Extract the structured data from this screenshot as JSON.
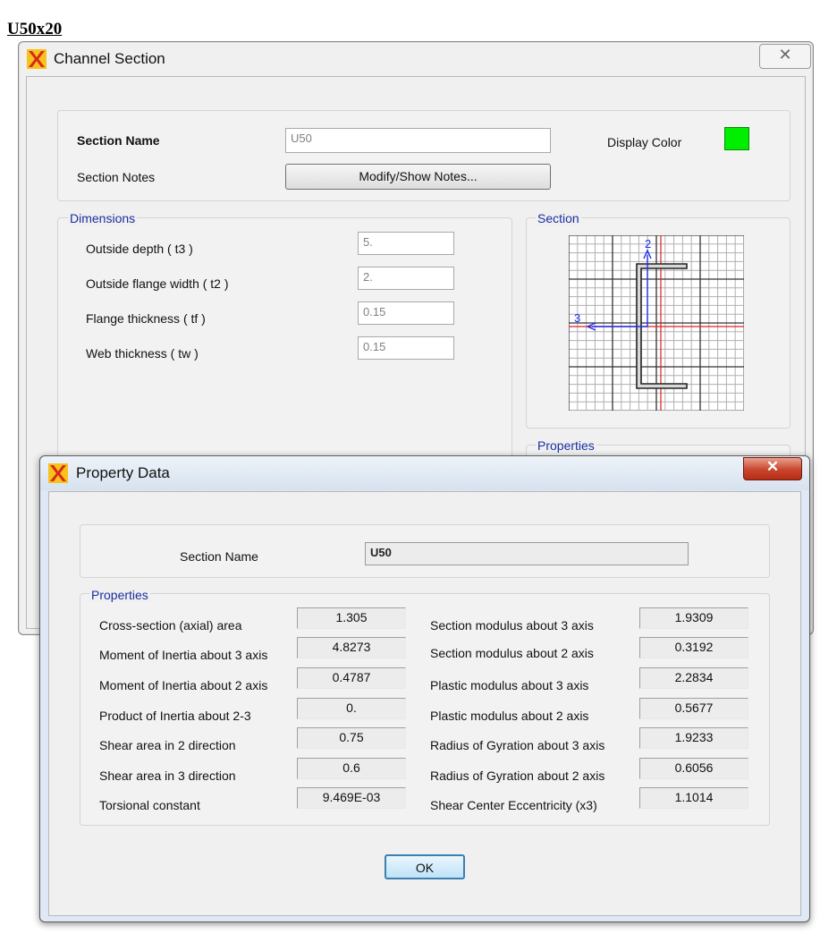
{
  "doc_title": "U50x20",
  "channel_window": {
    "title": "Channel Section",
    "close_label": "✕",
    "section_name_label": "Section Name",
    "section_name_value": "U50",
    "display_color_label": "Display Color",
    "display_color": "#00ee00",
    "section_notes_label": "Section Notes",
    "notes_button": "Modify/Show Notes...",
    "dimensions_label": "Dimensions",
    "dimensions": [
      {
        "label": "Outside depth  ( t3 )",
        "value": "5."
      },
      {
        "label": "Outside flange width  ( t2 )",
        "value": "2."
      },
      {
        "label": "Flange thickness  ( tf )",
        "value": "0.15"
      },
      {
        "label": "Web thickness  ( tw )",
        "value": "0.15"
      }
    ],
    "section_group_label": "Section",
    "axis_2_label": "2",
    "axis_3_label": "3",
    "properties_group_label": "Properties"
  },
  "property_window": {
    "title": "Property Data",
    "close_label": "✕",
    "section_name_label": "Section Name",
    "section_name_value": "U50",
    "properties_label": "Properties",
    "left": [
      {
        "label": "Cross-section (axial) area",
        "value": "1.305"
      },
      {
        "label": "Moment of Inertia about 3 axis",
        "value": "4.8273"
      },
      {
        "label": "Moment of Inertia about 2 axis",
        "value": "0.4787"
      },
      {
        "label": "Product of Inertia about 2-3",
        "value": "0."
      },
      {
        "label": "Shear area in 2 direction",
        "value": "0.75"
      },
      {
        "label": "Shear area in 3 direction",
        "value": "0.6"
      },
      {
        "label": "Torsional constant",
        "value": "9.469E-03"
      }
    ],
    "right": [
      {
        "label": "Section modulus about 3 axis",
        "value": "1.9309"
      },
      {
        "label": "Section modulus about 2 axis",
        "value": "0.3192"
      },
      {
        "label": "Plastic modulus about 3 axis",
        "value": "2.2834"
      },
      {
        "label": "Plastic modulus about 2 axis",
        "value": "0.5677"
      },
      {
        "label": "Radius of Gyration about 3 axis",
        "value": "1.9233"
      },
      {
        "label": "Radius of Gyration about 2 axis",
        "value": "0.6056"
      },
      {
        "label": "Shear Center Eccentricity (x3)",
        "value": "1.1014"
      }
    ],
    "ok_label": "OK"
  }
}
